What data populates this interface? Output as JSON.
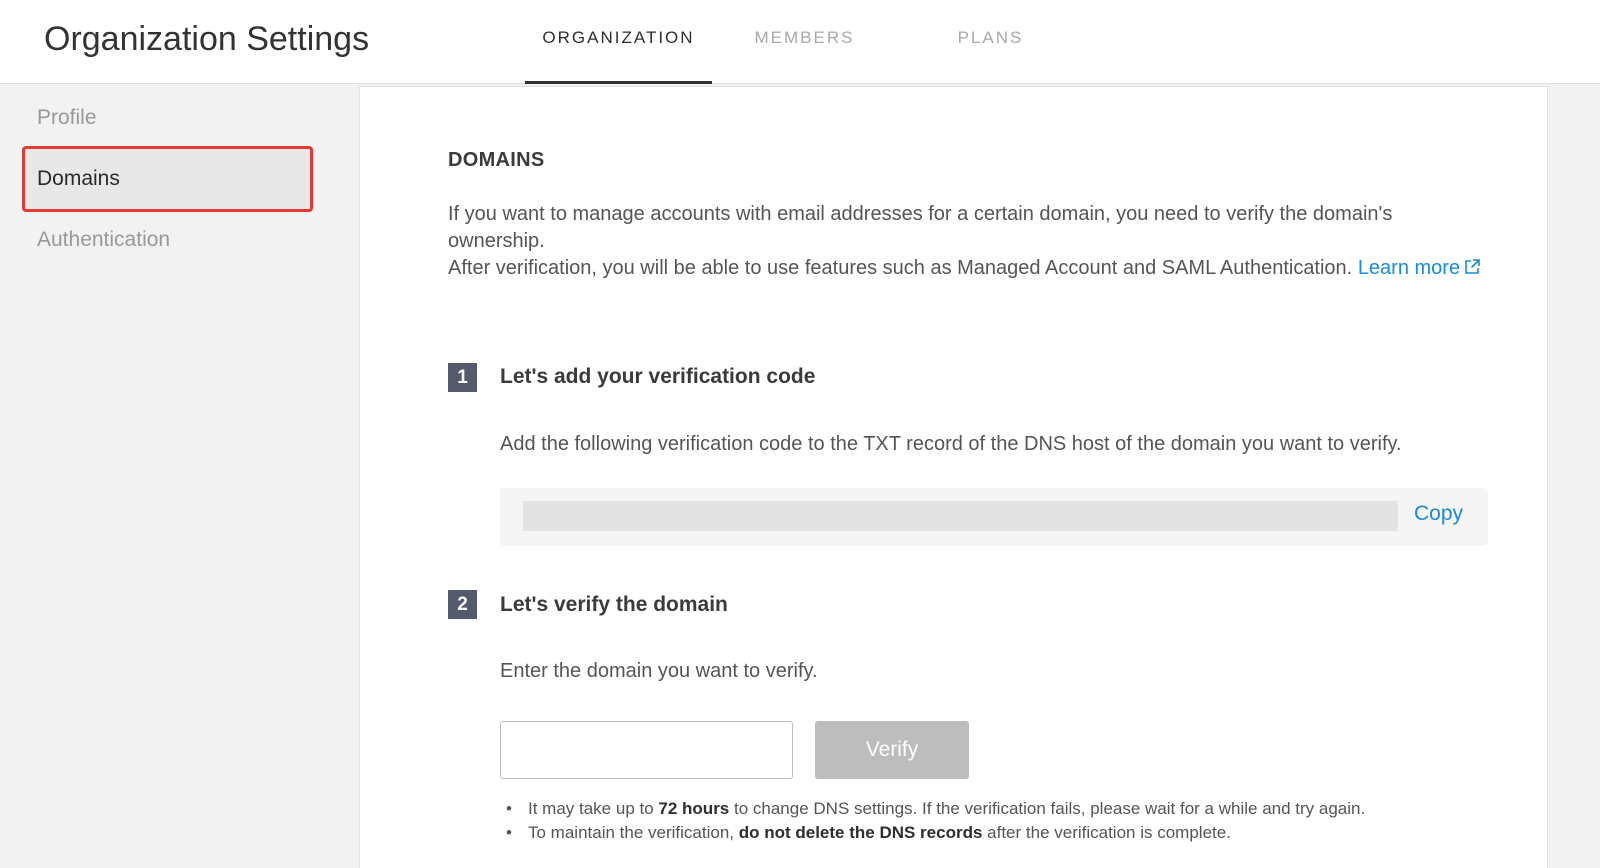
{
  "header": {
    "title": "Organization Settings",
    "tabs": [
      {
        "label": "ORGANIZATION",
        "active": true
      },
      {
        "label": "MEMBERS",
        "active": false
      },
      {
        "label": "PLANS",
        "active": false
      }
    ]
  },
  "sidebar": {
    "items": [
      {
        "label": "Profile"
      },
      {
        "label": "Domains",
        "active": true
      },
      {
        "label": "Authentication"
      }
    ]
  },
  "domains": {
    "title": "DOMAINS",
    "desc_line1": "If you want to manage accounts with email addresses for a certain domain, you need to verify the domain's ownership.",
    "desc_line2": "After verification, you will be able to use features such as Managed Account and SAML Authentication.",
    "learn_more": "Learn more",
    "step1": {
      "number": "1",
      "title": "Let's add your verification code",
      "desc": "Add the following verification code to the TXT record of the DNS host of the domain you want to verify.",
      "copy_label": "Copy"
    },
    "step2": {
      "number": "2",
      "title": "Let's verify the domain",
      "desc": "Enter the domain you want to verify.",
      "input_value": "",
      "verify_label": "Verify"
    },
    "notes": {
      "n1_pre": "It may take up to ",
      "n1_bold": "72 hours",
      "n1_post": " to change DNS settings. If the verification fails, please wait for a while and try again.",
      "n2_pre": "To maintain the verification, ",
      "n2_bold": "do not delete the DNS records",
      "n2_post": " after the verification is complete."
    }
  },
  "colors": {
    "link": "#1a8bd4",
    "highlight_border": "#e53935",
    "step_badge": "#545a6b",
    "verify_disabled": "#bdbdbd"
  }
}
